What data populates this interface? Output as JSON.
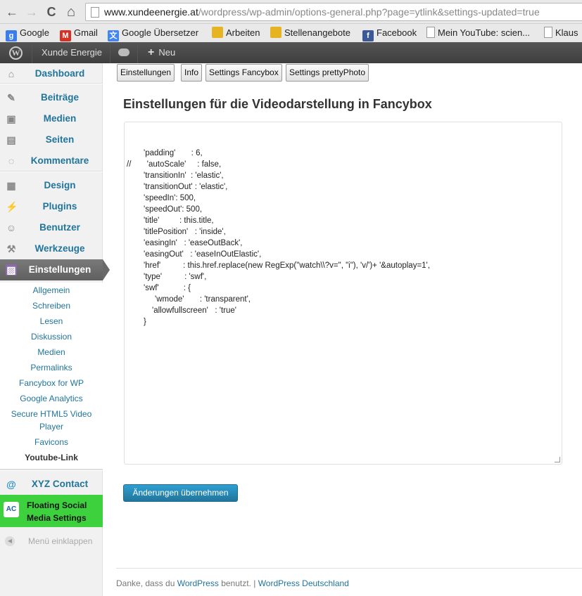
{
  "browser": {
    "url_host": "www.xundeenergie.at",
    "url_path": "/wordpress/wp-admin/options-general.php?page=ytlink&settings-updated=true",
    "nav": {
      "back": "←",
      "forward": "→",
      "reload": "C",
      "home": "⌂"
    },
    "bookmarks": [
      {
        "label": "Google",
        "icon": "google-icon",
        "color": "#3b7ded",
        "glyph": "g"
      },
      {
        "label": "Gmail",
        "icon": "gmail-icon",
        "color": "#d93025",
        "glyph": "M"
      },
      {
        "label": "Google Übersetzer",
        "icon": "translate-icon",
        "color": "#4285f4",
        "glyph": "文"
      },
      {
        "label": "Arbeiten",
        "icon": "folder-icon",
        "color": "#e6b422",
        "glyph": ""
      },
      {
        "label": "Stellenangebote",
        "icon": "folder-icon",
        "color": "#e6b422",
        "glyph": ""
      },
      {
        "label": "Facebook",
        "icon": "facebook-icon",
        "color": "#3b5998",
        "glyph": "f"
      },
      {
        "label": "Mein YouTube: scien...",
        "icon": "page-icon",
        "color": "#ffffff",
        "glyph": ""
      },
      {
        "label": "Klaus",
        "icon": "page-icon",
        "color": "#ffffff",
        "glyph": ""
      }
    ]
  },
  "adminbar": {
    "site_name": "Xunde Energie",
    "comments_icon": "comment-bubble-icon",
    "new_label": "Neu",
    "new_plus": "+",
    "wp_glyph": "W"
  },
  "sidebar": {
    "items": [
      {
        "label": "Dashboard",
        "icon": "home-icon",
        "glyph": "⌂"
      },
      {
        "label": "Beiträge",
        "icon": "pin-icon",
        "glyph": "✎"
      },
      {
        "label": "Medien",
        "icon": "media-icon",
        "glyph": "▣"
      },
      {
        "label": "Seiten",
        "icon": "pages-icon",
        "glyph": "▤"
      },
      {
        "label": "Kommentare",
        "icon": "comments-icon",
        "glyph": "◌"
      },
      {
        "label": "Design",
        "icon": "appearance-icon",
        "glyph": "▦"
      },
      {
        "label": "Plugins",
        "icon": "plugins-icon",
        "glyph": "⚡"
      },
      {
        "label": "Benutzer",
        "icon": "users-icon",
        "glyph": "☺"
      },
      {
        "label": "Werkzeuge",
        "icon": "tools-icon",
        "glyph": "⚒"
      },
      {
        "label": "Einstellungen",
        "icon": "settings-icon",
        "glyph": "▨"
      }
    ],
    "submenu": [
      "Allgemein",
      "Schreiben",
      "Lesen",
      "Diskussion",
      "Medien",
      "Permalinks",
      "Fancybox for WP",
      "Google Analytics",
      "Secure HTML5 Video",
      "Player",
      "Favicons",
      "Youtube-Link"
    ],
    "xyz_contact": {
      "label": "XYZ Contact",
      "glyph": "@"
    },
    "floating_social": {
      "line1": "Floating Social",
      "line2": "Media Settings",
      "glyph": "AC"
    },
    "collapse_label": "Menü einklappen",
    "collapse_glyph": "◀"
  },
  "tabs": [
    "Einstellungen",
    "Info",
    "Settings Fancybox",
    "Settings prettyPhoto"
  ],
  "page_title": "Einstellungen für die Videodarstellung in Fancybox",
  "code_lines": [
    {
      "indent": 1,
      "text": "'padding'       : 6,"
    },
    {
      "indent": 0,
      "text": "//       'autoScale'     : false,"
    },
    {
      "indent": 1,
      "text": "'transitionIn'  : 'elastic',"
    },
    {
      "indent": 1,
      "text": "'transitionOut' : 'elastic',"
    },
    {
      "indent": 1,
      "text": "'speedIn': 500,"
    },
    {
      "indent": 1,
      "text": "'speedOut': 500,"
    },
    {
      "indent": 1,
      "text": "'title'         : this.title,"
    },
    {
      "indent": 1,
      "text": "'titlePosition'   : 'inside',"
    },
    {
      "indent": 1,
      "text": "'easingIn'   : 'easeOutBack',"
    },
    {
      "indent": 1,
      "text": "'easingOut'   : 'easeInOutElastic',"
    },
    {
      "indent": 1,
      "text": "'href'          : this.href.replace(new RegExp(\"watch\\\\?v=\", \"i\"), 'v/')+ '&autoplay=1',"
    },
    {
      "indent": 1,
      "text": "'type'          : 'swf',"
    },
    {
      "indent": 1,
      "text": "'swf'           : {"
    },
    {
      "indent": 2,
      "text": "'wmode'       : 'transparent',"
    },
    {
      "indent": 3,
      "text": "'allowfullscreen'   : 'true'"
    },
    {
      "indent": 1,
      "text": "}"
    }
  ],
  "submit_label": "Änderungen übernehmen",
  "footer": {
    "prefix": "Danke, dass du ",
    "wp_link": "WordPress",
    "middle": " benutzt. | ",
    "wp_de_link": "WordPress Deutschland"
  }
}
